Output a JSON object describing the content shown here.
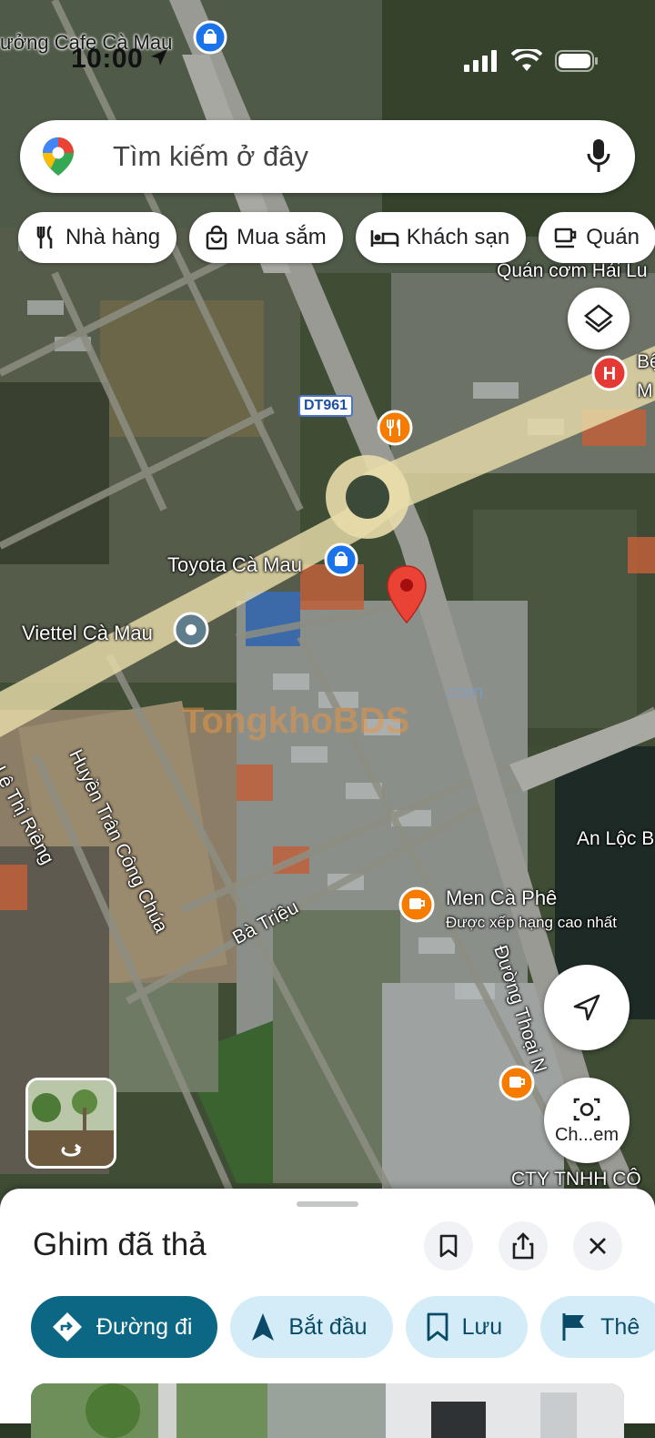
{
  "status_bar": {
    "time": "10:00"
  },
  "search": {
    "placeholder": "Tìm kiếm ở đây"
  },
  "chips": [
    {
      "label": "Nhà hàng",
      "icon": "fork-knife-icon"
    },
    {
      "label": "Mua sắm",
      "icon": "shopping-bag-icon"
    },
    {
      "label": "Khách sạn",
      "icon": "bed-icon"
    },
    {
      "label": "Quán",
      "icon": "coffee-cup-icon"
    }
  ],
  "map": {
    "labels": {
      "cafe_top": "ưởng Cafe Cà Mau",
      "quan_com": "Quán cơm Hải Lu",
      "hospital_b": "Bệ",
      "hospital_m": "M",
      "road_shield": "DT961",
      "toyota": "Toyota Cà Mau",
      "viettel": "Viettel Cà Mau",
      "huyen_tran": "Huyền Trân Công Chúa",
      "le_thi_rieng": "Lê Thị Riêng",
      "ba_trieu": "Bà Triệu",
      "an_loc": "An Lộc B",
      "men_ca_phe": "Men Cà Phê",
      "men_sub": "Được xếp hạng cao nhất",
      "duong_thoai": "Đường Thoại N",
      "cty": "CTY TNHH CÔ",
      "watermark": "TongkhoBDS",
      "watermark_com": ".com"
    },
    "explore_label": "Ch...em"
  },
  "sheet": {
    "title": "Ghim đã thả",
    "actions": [
      {
        "label": "Đường đi",
        "icon": "directions-icon"
      },
      {
        "label": "Bắt đầu",
        "icon": "navigation-arrow-icon"
      },
      {
        "label": "Lưu",
        "icon": "bookmark-icon"
      },
      {
        "label": "Thê",
        "icon": "flag-icon"
      }
    ]
  },
  "colors": {
    "accent": "#0b6784",
    "pin": "#ea4335",
    "pill": "#d3ecf7"
  }
}
